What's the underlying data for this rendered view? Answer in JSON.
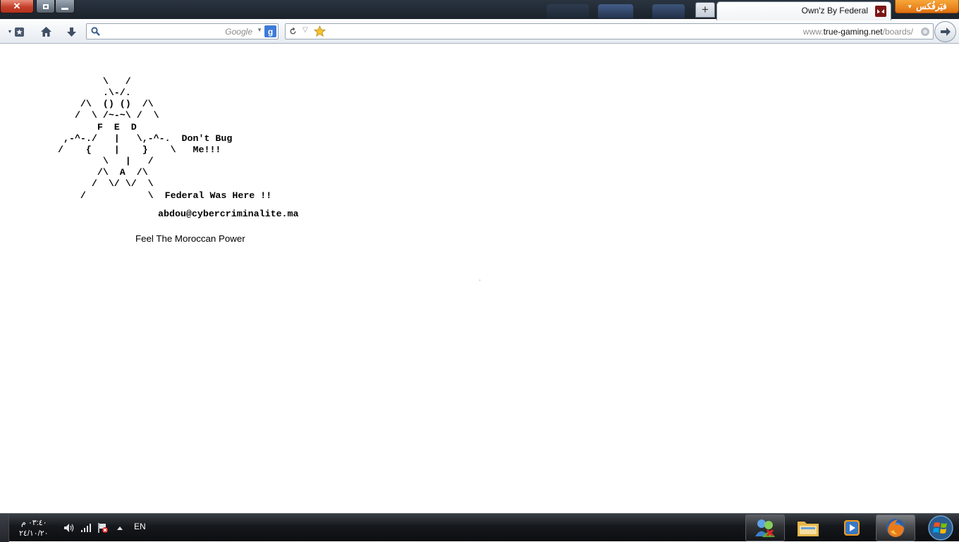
{
  "window": {
    "tab_title": "Own'z By Federal",
    "app_menu_label": "فيَرفُكس",
    "new_tab_symbol": "+"
  },
  "navbar": {
    "search_placeholder": "Google",
    "search_value": "",
    "url_prefix": "www.",
    "url_domain": "true-gaming.net",
    "url_path": "/boards/"
  },
  "page": {
    "ascii_art": "        \\   /\n        .\\-/.\n    /\\  () ()  /\\\n   /  \\ /~-~\\ /  \\\n       F  E  D\n ,-^-./   |   \\,-^-.  Don't Bug\n/    {    |    }    \\   Me!!!\n        \\   |   /\n       /\\  A  /\\\n      /  \\/ \\/  \\\n    /           \\  Federal Was Here !!",
    "email": "abdou@cybercriminalite.ma",
    "slogan": "Feel The Moroccan Power"
  },
  "taskbar": {
    "clock_time": "٠٣:٤٠ م",
    "clock_date": "٢٤/١٠/٢٠",
    "language": "EN"
  },
  "icons": {
    "close": "close-icon",
    "restore": "restore-icon",
    "minimize": "minimize-icon",
    "bookmarks": "bookmarks-icon",
    "home": "home-icon",
    "downloads": "download-icon",
    "search": "search-icon",
    "reload": "reload-icon",
    "star": "star-icon",
    "go": "go-arrow-icon"
  },
  "colors": {
    "firefox_orange": "#e0700f",
    "close_red": "#c4402a",
    "taskbar_dark": "#15181c"
  }
}
